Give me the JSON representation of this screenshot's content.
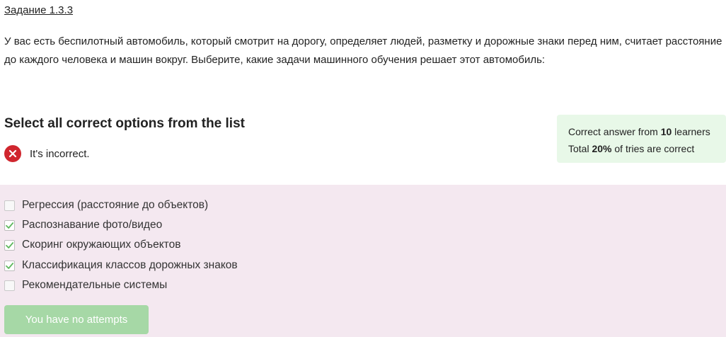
{
  "task": {
    "title": "Задание 1.3.3",
    "question": "У вас есть беспилотный автомобиль, который смотрит на дорогу, определяет людей, разметку и дорожные знаки перед ним, считает расстояние до каждого человека и машин вокруг. Выберите, какие задачи машинного обучения решает этот автомобиль:"
  },
  "quiz": {
    "instruction": "Select all correct options from the list",
    "status_text": "It's incorrect.",
    "status_icon": "close-icon",
    "status_color": "#d0262e",
    "stats": {
      "line1_prefix": "Correct answer from ",
      "line1_count": "10",
      "line1_suffix": " learners",
      "line2_prefix": "Total ",
      "line2_percent": "20%",
      "line2_suffix": " of tries are correct"
    },
    "options": [
      {
        "label": "Регрессия (расстояние до объектов)",
        "checked": false
      },
      {
        "label": "Распознавание фото/видео",
        "checked": true
      },
      {
        "label": "Скоринг окружающих объектов",
        "checked": true
      },
      {
        "label": "Классификация классов дорожных знаков",
        "checked": true
      },
      {
        "label": "Рекомендательные системы",
        "checked": false
      }
    ],
    "submit_label": "You have no attempts",
    "accent_color": "#5fb85f"
  }
}
